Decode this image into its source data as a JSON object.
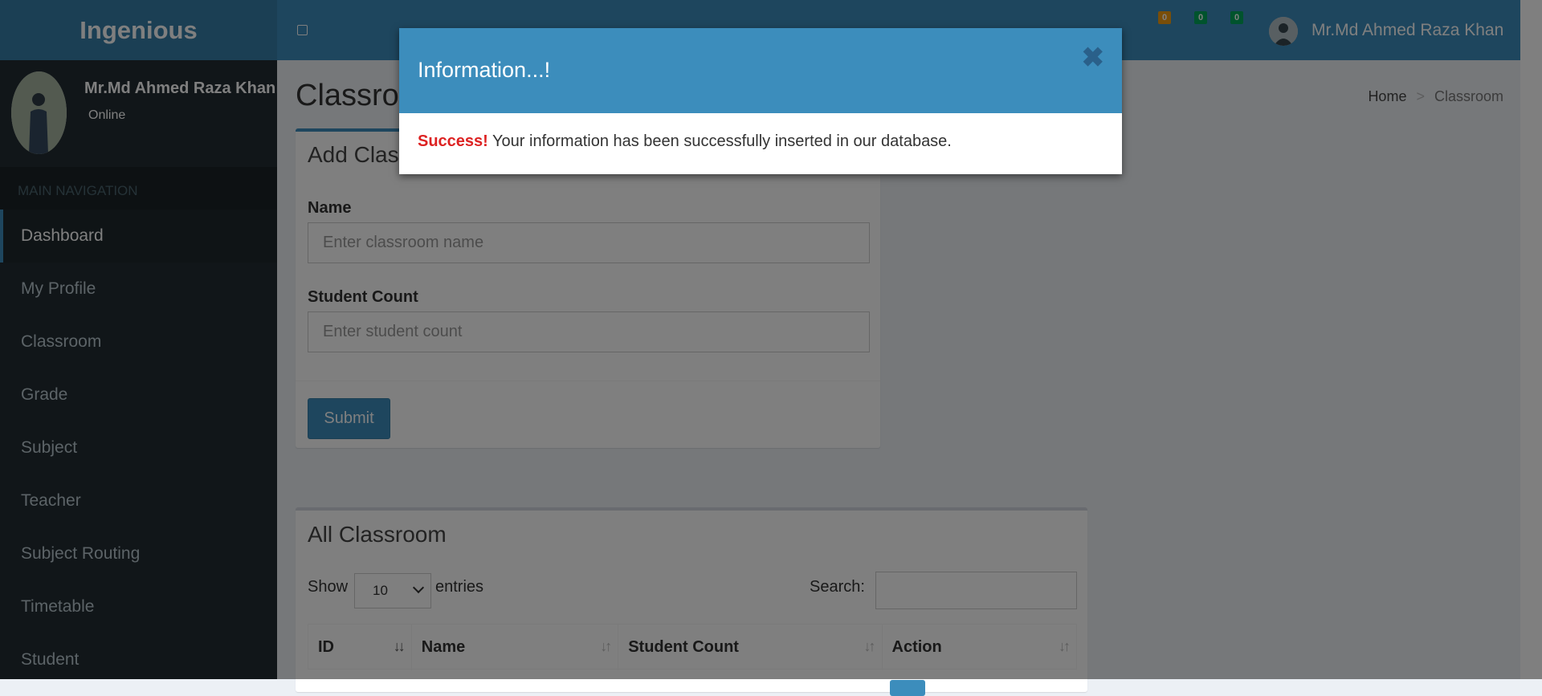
{
  "header": {
    "logo": "Ingenious",
    "user_name": "Mr.Md Ahmed Raza Khan",
    "badges": [
      {
        "count": "0",
        "color": "#f39c12"
      },
      {
        "count": "0",
        "color": "#00a65a"
      },
      {
        "count": "0",
        "color": "#00a65a"
      }
    ]
  },
  "sidebar": {
    "user_name": "Mr.Md Ahmed Raza Khan",
    "status": "Online",
    "section_header": "MAIN NAVIGATION",
    "items": [
      {
        "label": "Dashboard"
      },
      {
        "label": "My Profile"
      },
      {
        "label": "Classroom"
      },
      {
        "label": "Grade"
      },
      {
        "label": "Subject"
      },
      {
        "label": "Teacher"
      },
      {
        "label": "Subject Routing"
      },
      {
        "label": "Timetable"
      },
      {
        "label": "Student"
      }
    ]
  },
  "page": {
    "title": "Classroom",
    "breadcrumb": {
      "home": "Home",
      "separator": ">",
      "current": "Classroom"
    }
  },
  "add_form": {
    "title": "Add Classroom",
    "name_label": "Name",
    "name_placeholder": "Enter classroom name",
    "count_label": "Student Count",
    "count_placeholder": "Enter student count",
    "submit_label": "Submit"
  },
  "table": {
    "title": "All Classroom",
    "show_label": "Show",
    "entries_value": "10",
    "entries_label": "entries",
    "search_label": "Search:",
    "columns": [
      "ID",
      "Name",
      "Student Count",
      "Action"
    ]
  },
  "modal": {
    "title": "Information...!",
    "close": "✖",
    "success_label": "Success!",
    "message": " Your information has been successfully inserted in our database."
  },
  "colors": {
    "primary": "#3c8dbc",
    "sidebar_bg": "#222d32",
    "success_text": "#dd2222"
  }
}
